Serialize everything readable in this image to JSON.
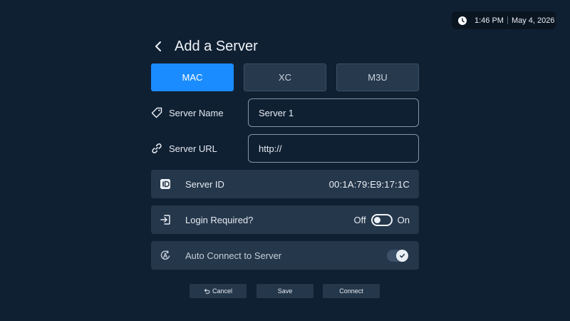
{
  "status_bar": {
    "time": "1:46 PM",
    "date": "May 4, 2026",
    "icon": "clock-icon"
  },
  "header": {
    "title": "Add a Server",
    "back_icon": "back-chevron-icon"
  },
  "tabs": [
    {
      "label": "MAC",
      "active": true
    },
    {
      "label": "XC",
      "active": false
    },
    {
      "label": "M3U",
      "active": false
    }
  ],
  "fields": {
    "server_name": {
      "label": "Server Name",
      "value": "Server 1",
      "icon": "tag-icon"
    },
    "server_url": {
      "label": "Server URL",
      "value": "http://",
      "icon": "link-icon"
    }
  },
  "server_id": {
    "label": "Server ID",
    "value": "00:1A:79:E9:17:1C",
    "icon": "id-badge-icon"
  },
  "login_required": {
    "label": "Login Required?",
    "off_label": "Off",
    "on_label": "On",
    "state": false,
    "icon": "login-icon"
  },
  "auto_connect": {
    "label": "Auto Connect to Server",
    "state": true,
    "icon": "auto-connect-icon"
  },
  "actions": {
    "cancel": "Cancel",
    "save": "Save",
    "connect": "Connect"
  },
  "colors": {
    "background": "#102033",
    "panel": "#25374b",
    "accent": "#1a8cff"
  }
}
